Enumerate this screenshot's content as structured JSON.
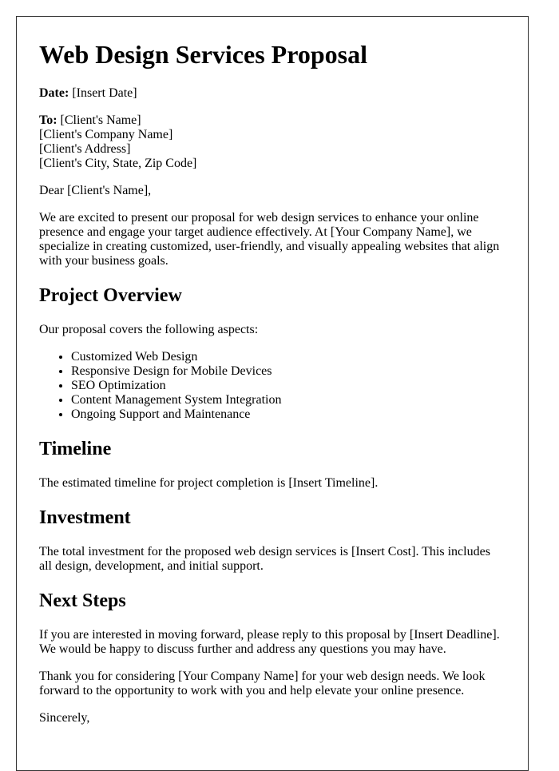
{
  "title": "Web Design Services Proposal",
  "date": {
    "label": "Date:",
    "value": "[Insert Date]"
  },
  "recipient": {
    "label": "To:",
    "name": "[Client's Name]",
    "company": "[Client's Company Name]",
    "address": "[Client's Address]",
    "city_state_zip": "[Client's City, State, Zip Code]"
  },
  "salutation": "Dear [Client's Name],",
  "intro": "We are excited to present our proposal for web design services to enhance your online presence and engage your target audience effectively. At [Your Company Name], we specialize in creating customized, user-friendly, and visually appealing websites that align with your business goals.",
  "sections": {
    "overview": {
      "heading": "Project Overview",
      "text": "Our proposal covers the following aspects:",
      "items": [
        "Customized Web Design",
        "Responsive Design for Mobile Devices",
        "SEO Optimization",
        "Content Management System Integration",
        "Ongoing Support and Maintenance"
      ]
    },
    "timeline": {
      "heading": "Timeline",
      "text": "The estimated timeline for project completion is [Insert Timeline]."
    },
    "investment": {
      "heading": "Investment",
      "text": "The total investment for the proposed web design services is [Insert Cost]. This includes all design, development, and initial support."
    },
    "next_steps": {
      "heading": "Next Steps",
      "text": "If you are interested in moving forward, please reply to this proposal by [Insert Deadline]. We would be happy to discuss further and address any questions you may have."
    }
  },
  "closing_text": "Thank you for considering [Your Company Name] for your web design needs. We look forward to the opportunity to work with you and help elevate your online presence.",
  "signoff": "Sincerely,"
}
